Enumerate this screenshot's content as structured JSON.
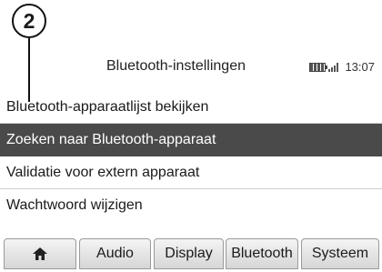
{
  "callout": {
    "number": "2"
  },
  "header": {
    "title": "Bluetooth-instellingen",
    "time": "13:07",
    "icons": {
      "battery": "battery-icon",
      "signal": "signal-icon"
    }
  },
  "menu": {
    "items": [
      {
        "label": "Bluetooth-apparaatlijst bekijken",
        "selected": false
      },
      {
        "label": "Zoeken naar Bluetooth-apparaat",
        "selected": true
      },
      {
        "label": "Validatie voor extern apparaat",
        "selected": false
      },
      {
        "label": "Wachtwoord wijzigen",
        "selected": false
      }
    ]
  },
  "tabs": [
    {
      "icon": "home-icon"
    },
    {
      "label": "Audio"
    },
    {
      "label": "Display"
    },
    {
      "label": "Bluetooth"
    },
    {
      "label": "Systeem"
    }
  ],
  "colors": {
    "selected_row": "#4a4a4a",
    "selected_text": "#ffffff",
    "tab_gradient_top": "#f4f4f4",
    "tab_gradient_bottom": "#d6d6d6"
  }
}
